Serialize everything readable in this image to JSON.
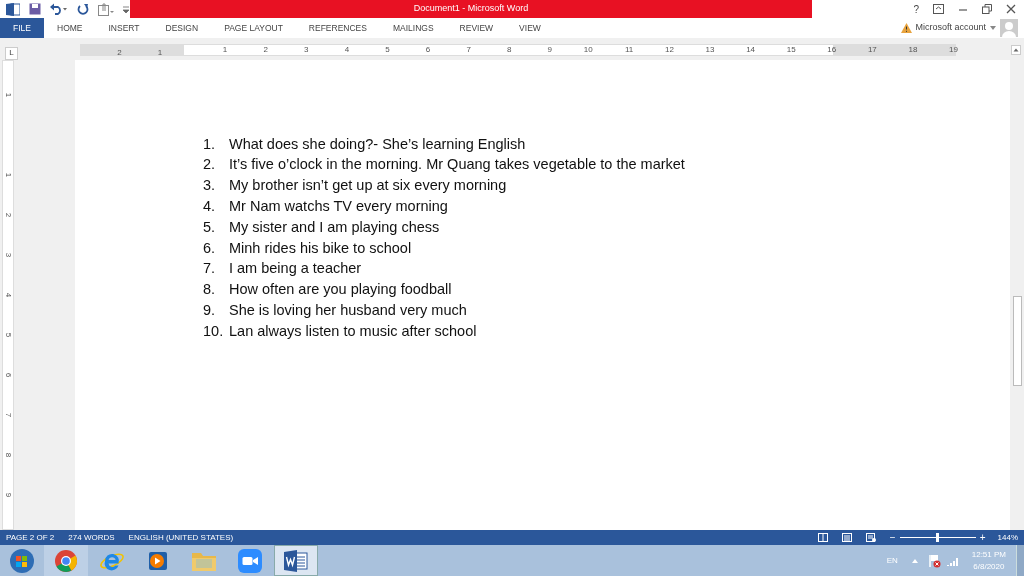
{
  "window": {
    "title": "Document1 - Microsoft Word"
  },
  "ribbon_tabs": [
    {
      "label": "FILE",
      "selected": true
    },
    {
      "label": "HOME",
      "selected": false
    },
    {
      "label": "INSERT",
      "selected": false
    },
    {
      "label": "DESIGN",
      "selected": false
    },
    {
      "label": "PAGE LAYOUT",
      "selected": false
    },
    {
      "label": "REFERENCES",
      "selected": false
    },
    {
      "label": "MAILINGS",
      "selected": false
    },
    {
      "label": "REVIEW",
      "selected": false
    },
    {
      "label": "VIEW",
      "selected": false
    }
  ],
  "account": {
    "label": "Microsoft account"
  },
  "window_buttons": [
    "?"
  ],
  "ruler": {
    "tab_selector": "L",
    "left_labels": [
      "2",
      "1"
    ],
    "labels": [
      "1",
      "2",
      "3",
      "4",
      "5",
      "6",
      "7",
      "8",
      "9",
      "10",
      "11",
      "12",
      "13",
      "14",
      "15",
      "16",
      "17",
      "18",
      "19"
    ]
  },
  "vertical_ruler": [
    "1",
    "1",
    "2",
    "3",
    "4",
    "5",
    "6",
    "7",
    "8",
    "9"
  ],
  "document": {
    "items": [
      {
        "number": "1.",
        "text": "What does she doing?- She’s learning English"
      },
      {
        "number": "2.",
        "text": "It’s five o’clock in the morning. Mr Quang takes vegetable to the market"
      },
      {
        "number": "3.",
        "text": "My brother isn’t get up at six every morning"
      },
      {
        "number": "4.",
        "text": "Mr Nam watchs TV every morning"
      },
      {
        "number": "5.",
        "text": "My sister and I am playing chess"
      },
      {
        "number": "6.",
        "text": "Minh rides his bike to school"
      },
      {
        "number": "7.",
        "text": "I am being a teacher"
      },
      {
        "number": "8.",
        "text": "How often are you playing foodball"
      },
      {
        "number": "9.",
        "text": "She is loving her husband very much"
      },
      {
        "number": "10.",
        "text": "Lan always listen to music after school"
      }
    ]
  },
  "status_bar": {
    "items": [
      "PAGE 2 OF 2",
      "274 WORDS",
      "ENGLISH (UNITED STATES)"
    ],
    "zoom": {
      "minus": "−",
      "plus": "+",
      "level": 0.5,
      "reading": "144%"
    }
  },
  "taskbar": {
    "apps": [
      {
        "kind": "chrome",
        "selected": false
      },
      {
        "kind": "ie",
        "selected": false
      },
      {
        "kind": "media",
        "selected": false
      },
      {
        "kind": "folder",
        "selected": false
      },
      {
        "kind": "zoom",
        "selected": false
      },
      {
        "kind": "word",
        "selected": true
      }
    ],
    "language": "EN",
    "time": "12:51 PM",
    "date": "6/8/2020"
  }
}
